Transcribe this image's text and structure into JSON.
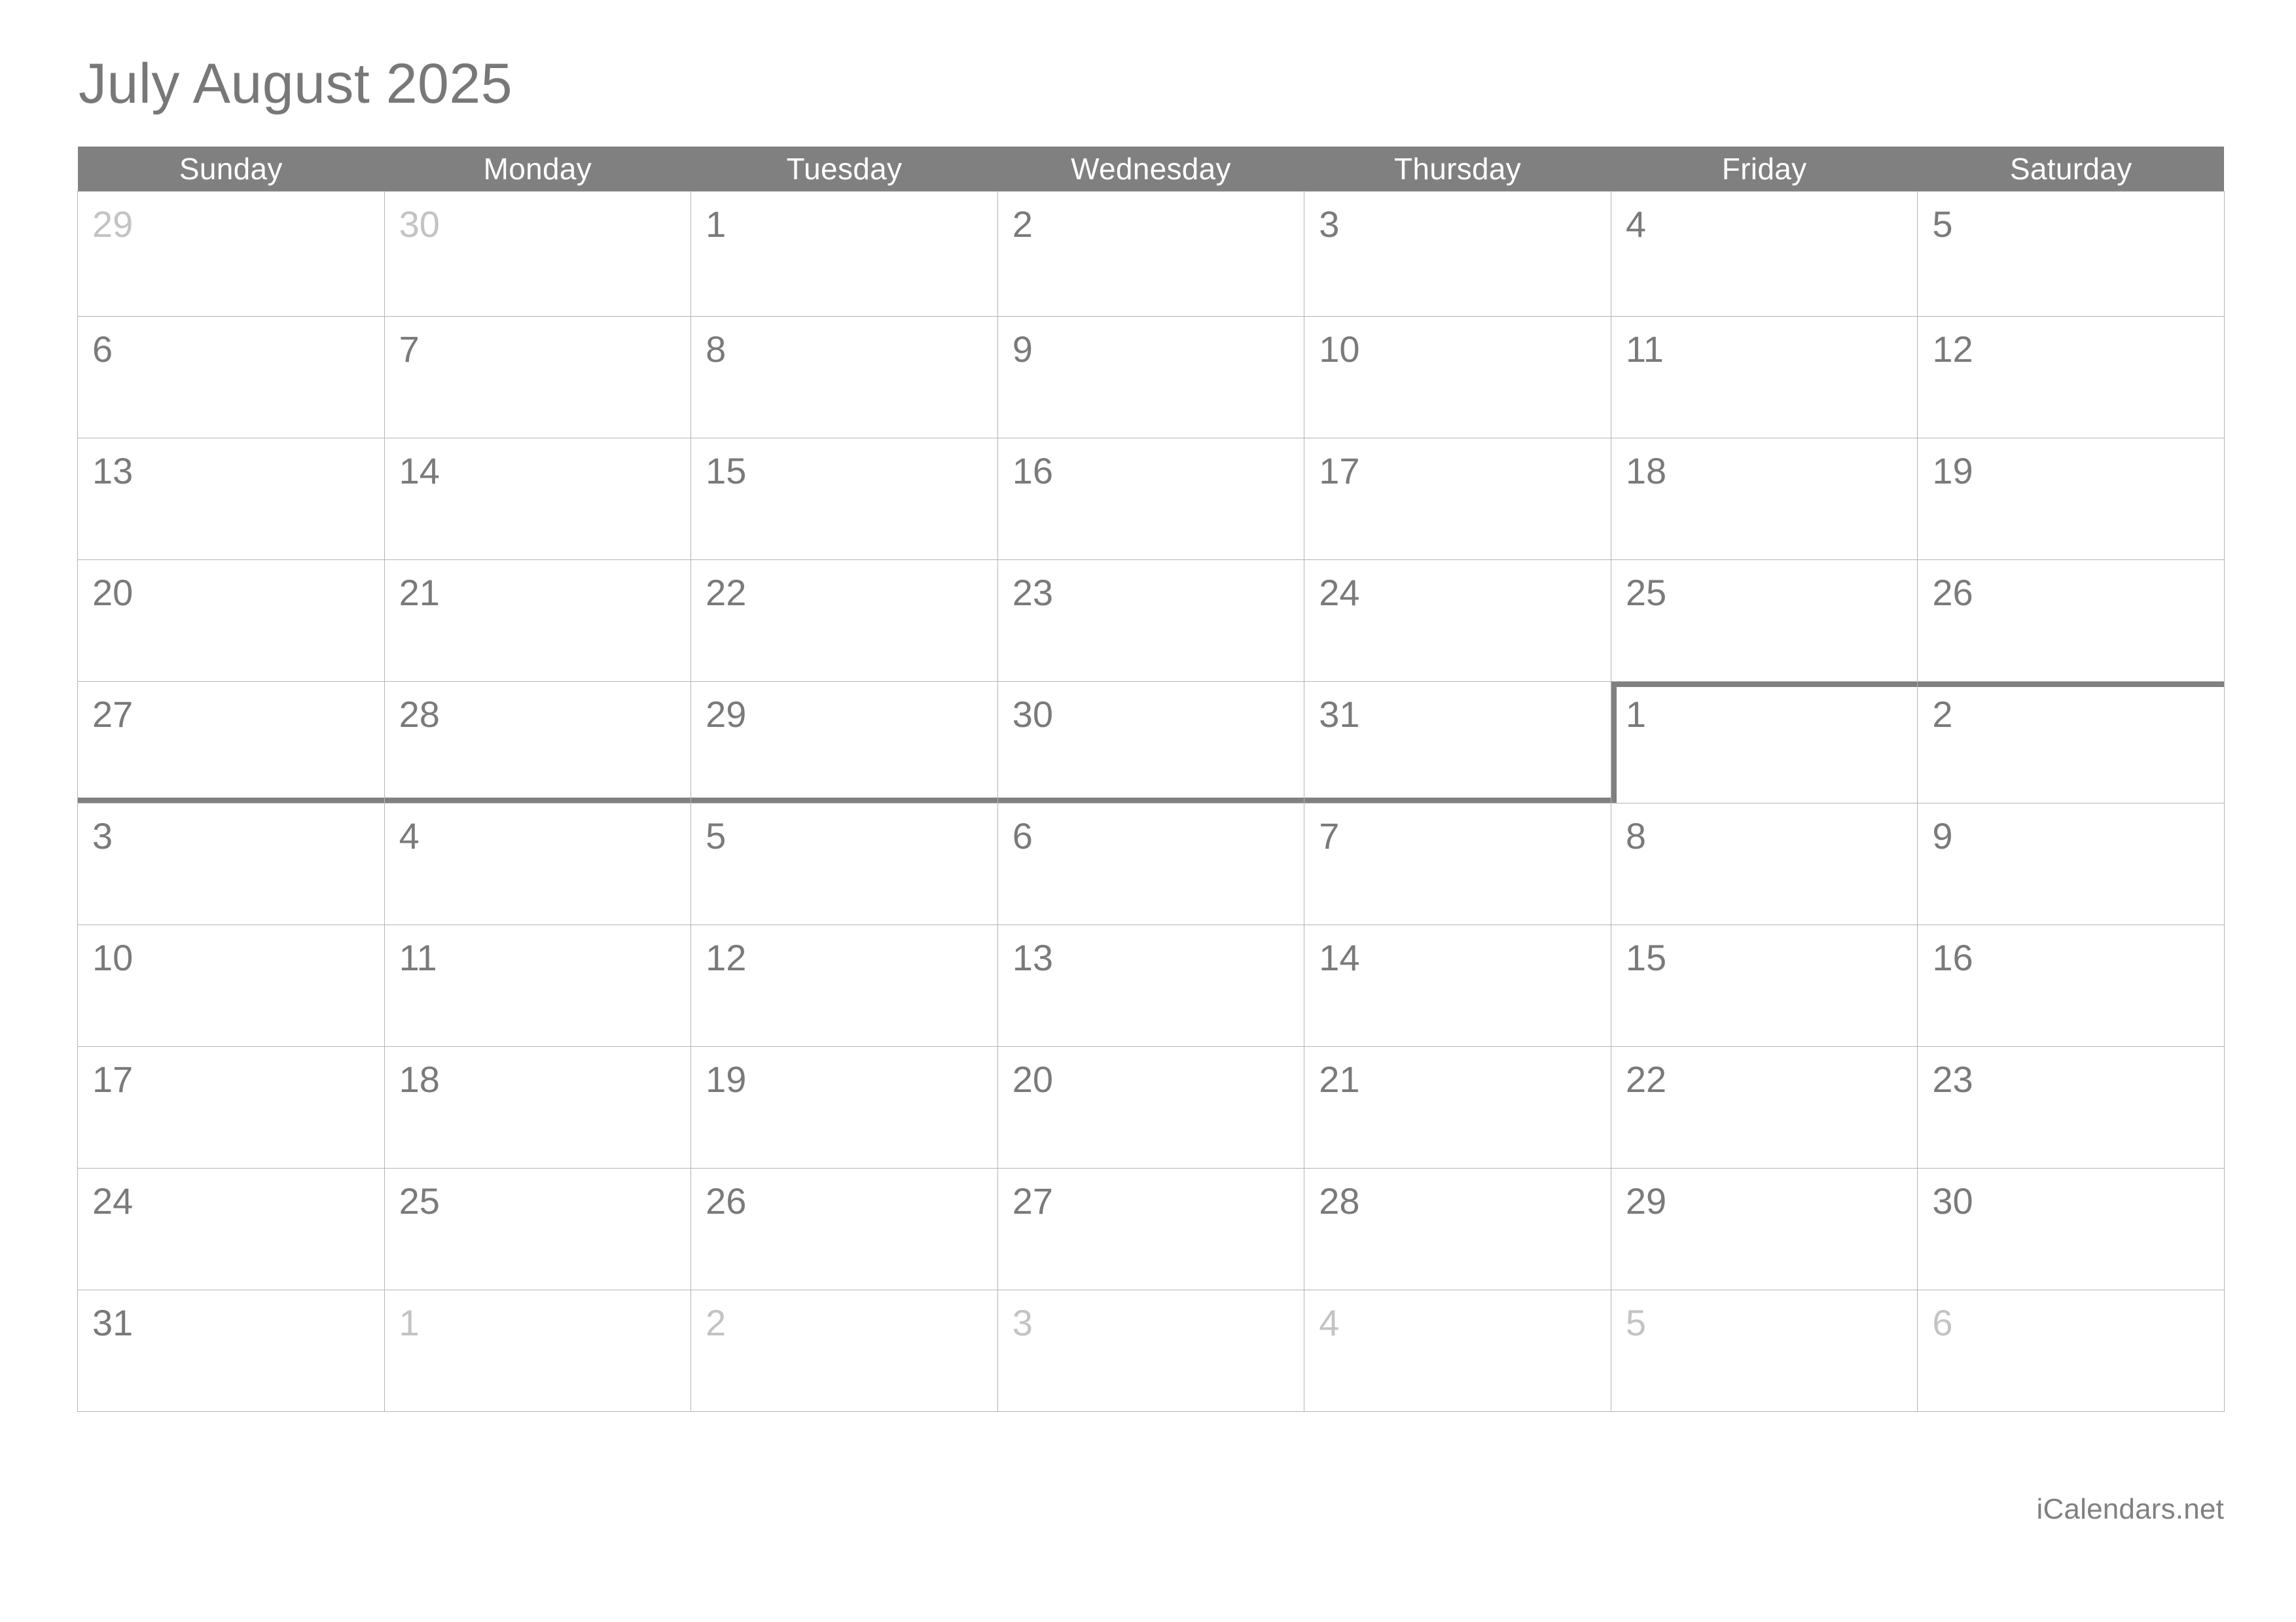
{
  "title": "July August 2025",
  "footer": {
    "brand": "iCalendars.net"
  },
  "colors": {
    "header_bg": "#808080",
    "header_text": "#ffffff",
    "grid_line": "#b4b4b4",
    "day_number": "#7a7a7a",
    "muted_cell_bg": "#f0f0f0",
    "muted_day_number": "#c3c3c3",
    "month_boundary": "#808080",
    "title_text": "#787878",
    "page_bg": "#ffffff"
  },
  "weekdays": [
    "Sunday",
    "Monday",
    "Tuesday",
    "Wednesday",
    "Thursday",
    "Friday",
    "Saturday"
  ],
  "weeks": [
    {
      "days": [
        {
          "num": "29",
          "muted": true,
          "boundary": ""
        },
        {
          "num": "30",
          "muted": true,
          "boundary": ""
        },
        {
          "num": "1",
          "muted": false,
          "boundary": ""
        },
        {
          "num": "2",
          "muted": false,
          "boundary": ""
        },
        {
          "num": "3",
          "muted": false,
          "boundary": ""
        },
        {
          "num": "4",
          "muted": false,
          "boundary": ""
        },
        {
          "num": "5",
          "muted": false,
          "boundary": ""
        }
      ]
    },
    {
      "days": [
        {
          "num": "6",
          "muted": false,
          "boundary": ""
        },
        {
          "num": "7",
          "muted": false,
          "boundary": ""
        },
        {
          "num": "8",
          "muted": false,
          "boundary": ""
        },
        {
          "num": "9",
          "muted": false,
          "boundary": ""
        },
        {
          "num": "10",
          "muted": false,
          "boundary": ""
        },
        {
          "num": "11",
          "muted": false,
          "boundary": ""
        },
        {
          "num": "12",
          "muted": false,
          "boundary": ""
        }
      ]
    },
    {
      "days": [
        {
          "num": "13",
          "muted": false,
          "boundary": ""
        },
        {
          "num": "14",
          "muted": false,
          "boundary": ""
        },
        {
          "num": "15",
          "muted": false,
          "boundary": ""
        },
        {
          "num": "16",
          "muted": false,
          "boundary": ""
        },
        {
          "num": "17",
          "muted": false,
          "boundary": ""
        },
        {
          "num": "18",
          "muted": false,
          "boundary": ""
        },
        {
          "num": "19",
          "muted": false,
          "boundary": ""
        }
      ]
    },
    {
      "days": [
        {
          "num": "20",
          "muted": false,
          "boundary": ""
        },
        {
          "num": "21",
          "muted": false,
          "boundary": ""
        },
        {
          "num": "22",
          "muted": false,
          "boundary": ""
        },
        {
          "num": "23",
          "muted": false,
          "boundary": ""
        },
        {
          "num": "24",
          "muted": false,
          "boundary": ""
        },
        {
          "num": "25",
          "muted": false,
          "boundary": "mb-bottom-thick-friday"
        },
        {
          "num": "26",
          "muted": false,
          "boundary": "mb-bottom-thick-saturday"
        }
      ]
    },
    {
      "days": [
        {
          "num": "27",
          "muted": false,
          "boundary": "mb-bottom"
        },
        {
          "num": "28",
          "muted": false,
          "boundary": "mb-bottom"
        },
        {
          "num": "29",
          "muted": false,
          "boundary": "mb-bottom"
        },
        {
          "num": "30",
          "muted": false,
          "boundary": "mb-bottom"
        },
        {
          "num": "31",
          "muted": false,
          "boundary": "mb-bottom"
        },
        {
          "num": "1",
          "muted": false,
          "boundary": "mb-topleft"
        },
        {
          "num": "2",
          "muted": false,
          "boundary": "mb-top"
        }
      ]
    },
    {
      "days": [
        {
          "num": "3",
          "muted": false,
          "boundary": ""
        },
        {
          "num": "4",
          "muted": false,
          "boundary": ""
        },
        {
          "num": "5",
          "muted": false,
          "boundary": ""
        },
        {
          "num": "6",
          "muted": false,
          "boundary": ""
        },
        {
          "num": "7",
          "muted": false,
          "boundary": ""
        },
        {
          "num": "8",
          "muted": false,
          "boundary": ""
        },
        {
          "num": "9",
          "muted": false,
          "boundary": ""
        }
      ]
    },
    {
      "days": [
        {
          "num": "10",
          "muted": false,
          "boundary": ""
        },
        {
          "num": "11",
          "muted": false,
          "boundary": ""
        },
        {
          "num": "12",
          "muted": false,
          "boundary": ""
        },
        {
          "num": "13",
          "muted": false,
          "boundary": ""
        },
        {
          "num": "14",
          "muted": false,
          "boundary": ""
        },
        {
          "num": "15",
          "muted": false,
          "boundary": ""
        },
        {
          "num": "16",
          "muted": false,
          "boundary": ""
        }
      ]
    },
    {
      "days": [
        {
          "num": "17",
          "muted": false,
          "boundary": ""
        },
        {
          "num": "18",
          "muted": false,
          "boundary": ""
        },
        {
          "num": "19",
          "muted": false,
          "boundary": ""
        },
        {
          "num": "20",
          "muted": false,
          "boundary": ""
        },
        {
          "num": "21",
          "muted": false,
          "boundary": ""
        },
        {
          "num": "22",
          "muted": false,
          "boundary": ""
        },
        {
          "num": "23",
          "muted": false,
          "boundary": ""
        }
      ]
    },
    {
      "days": [
        {
          "num": "24",
          "muted": false,
          "boundary": ""
        },
        {
          "num": "25",
          "muted": false,
          "boundary": ""
        },
        {
          "num": "26",
          "muted": false,
          "boundary": ""
        },
        {
          "num": "27",
          "muted": false,
          "boundary": ""
        },
        {
          "num": "28",
          "muted": false,
          "boundary": ""
        },
        {
          "num": "29",
          "muted": false,
          "boundary": ""
        },
        {
          "num": "30",
          "muted": false,
          "boundary": ""
        }
      ]
    },
    {
      "days": [
        {
          "num": "31",
          "muted": false,
          "boundary": ""
        },
        {
          "num": "1",
          "muted": true,
          "boundary": ""
        },
        {
          "num": "2",
          "muted": true,
          "boundary": ""
        },
        {
          "num": "3",
          "muted": true,
          "boundary": ""
        },
        {
          "num": "4",
          "muted": true,
          "boundary": ""
        },
        {
          "num": "5",
          "muted": true,
          "boundary": ""
        },
        {
          "num": "6",
          "muted": true,
          "boundary": ""
        }
      ]
    }
  ]
}
